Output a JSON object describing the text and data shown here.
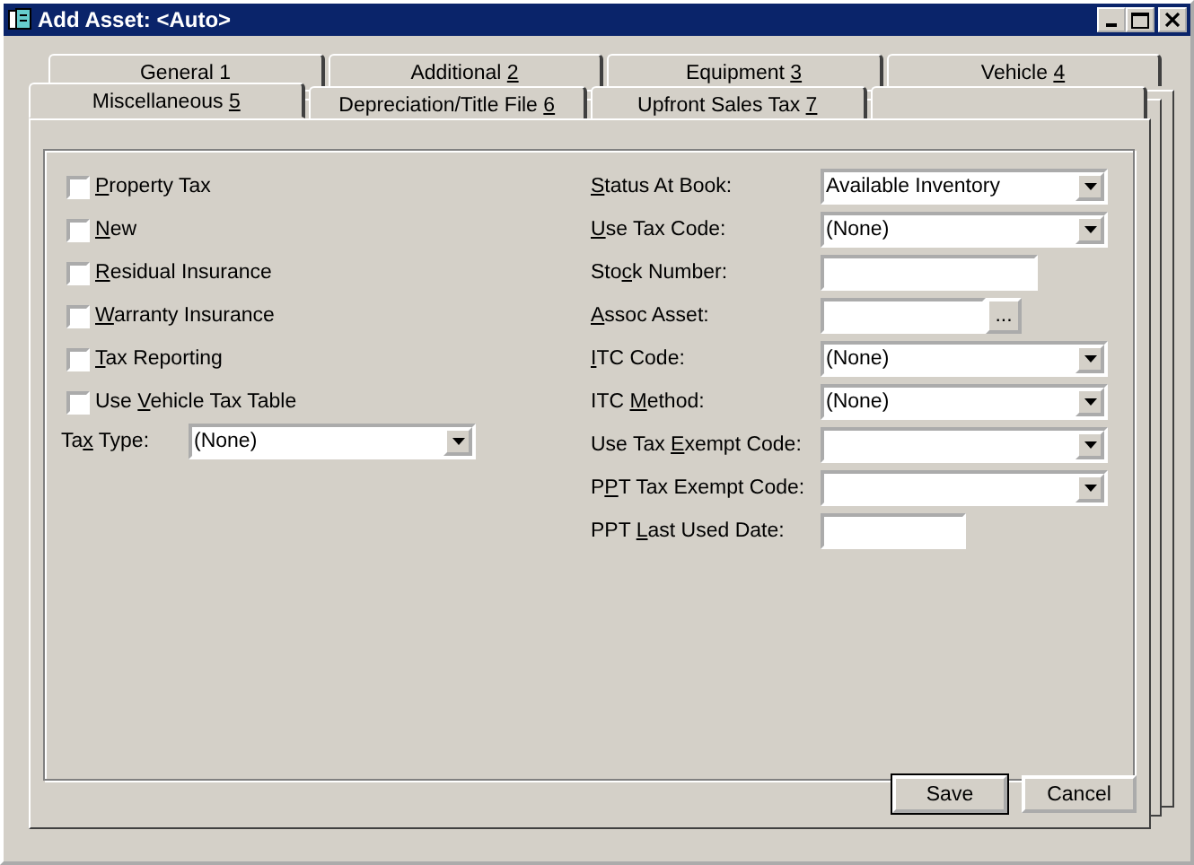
{
  "window": {
    "title": "Add Asset: <Auto>"
  },
  "tab_rows": [
    {
      "tabs": [
        {
          "label": {
            "pre": "General 1"
          },
          "selected": false
        },
        {
          "label": {
            "pre": "Additional ",
            "key": "2"
          },
          "selected": false
        },
        {
          "label": {
            "pre": "Equipment ",
            "key": "3"
          },
          "selected": false
        },
        {
          "label": {
            "pre": "Vehicle ",
            "key": "4"
          },
          "selected": false
        }
      ]
    },
    {
      "tabs": [
        {
          "label": {
            "pre": "Miscellaneous ",
            "key": "5"
          },
          "selected": true
        },
        {
          "label": {
            "pre": "Depreciation/Title File ",
            "key": "6"
          },
          "selected": false
        },
        {
          "label": {
            "pre": "Upfront Sales Tax ",
            "key": "7"
          },
          "selected": false
        },
        {
          "selected": false
        }
      ]
    }
  ],
  "checkboxes": [
    {
      "label": {
        "key": "P",
        "post": "roperty Tax"
      },
      "checked": false
    },
    {
      "label": {
        "key": "N",
        "post": "ew"
      },
      "checked": false
    },
    {
      "label": {
        "key": "R",
        "post": "esidual Insurance"
      },
      "checked": false
    },
    {
      "label": {
        "key": "W",
        "post": "arranty Insurance"
      },
      "checked": false
    },
    {
      "label": {
        "key": "T",
        "post": "ax Reporting"
      },
      "checked": false
    },
    {
      "label": {
        "pre": "Use ",
        "key": "V",
        "post": "ehicle Tax Table"
      },
      "checked": false
    }
  ],
  "tax_type": {
    "label": {
      "pre": "Ta",
      "key": "x",
      "post": " Type:"
    },
    "value": "(None)"
  },
  "fields": [
    {
      "kind": "combo",
      "label": {
        "key": "S",
        "post": "tatus At Book:"
      },
      "value": "Available Inventory"
    },
    {
      "kind": "combo",
      "label": {
        "key": "U",
        "post": "se Tax Code:"
      },
      "value": "(None)"
    },
    {
      "kind": "text",
      "label": {
        "pre": "Sto",
        "key": "c",
        "post": "k Number:"
      }
    },
    {
      "kind": "browse",
      "label": {
        "key": "A",
        "post": "ssoc Asset:"
      },
      "button": "..."
    },
    {
      "kind": "combo",
      "label": {
        "key": "I",
        "post": "TC Code:"
      },
      "value": "(None)"
    },
    {
      "kind": "combo",
      "label": {
        "pre": "ITC ",
        "key": "M",
        "post": "ethod:"
      },
      "value": "(None)"
    },
    {
      "kind": "combo",
      "label": {
        "pre": "Use Tax ",
        "key": "E",
        "post": "xempt Code:"
      }
    },
    {
      "kind": "combo",
      "label": {
        "pre": "P",
        "key": "P",
        "post": "T Tax Exempt Code:"
      }
    },
    {
      "kind": "date",
      "label": {
        "pre": "PPT ",
        "key": "L",
        "post": "ast Used Date:"
      }
    }
  ],
  "buttons": [
    {
      "label": "Save",
      "default": true
    },
    {
      "label": "Cancel",
      "default": false
    }
  ]
}
